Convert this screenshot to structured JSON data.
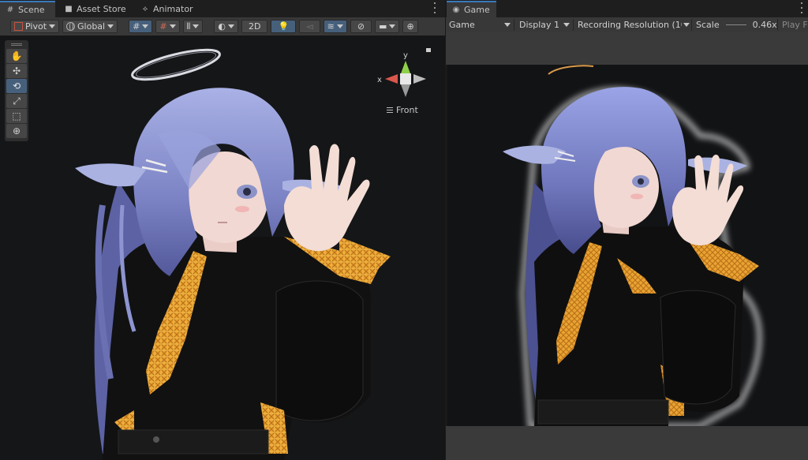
{
  "tabs": {
    "scene": "Scene",
    "asset_store": "Asset Store",
    "animator": "Animator",
    "game": "Game"
  },
  "scene_toolbar": {
    "pivot": "Pivot",
    "global": "Global",
    "mode_2d": "2D"
  },
  "gizmo": {
    "axis_y": "y",
    "axis_x": "x",
    "view_label": "Front"
  },
  "game_toolbar": {
    "mode": "Game",
    "display": "Display 1",
    "resolution": "Recording Resolution (10(",
    "scale_label": "Scale",
    "scale_value": "0.46x",
    "play_label": "Play F"
  },
  "colors": {
    "accent": "#3a79bb",
    "toggle_on": "#46607c",
    "panel": "#383838",
    "viewport": "#151618",
    "tie": "#e8a838",
    "hair": "#8a93c9",
    "jacket": "#141414"
  }
}
